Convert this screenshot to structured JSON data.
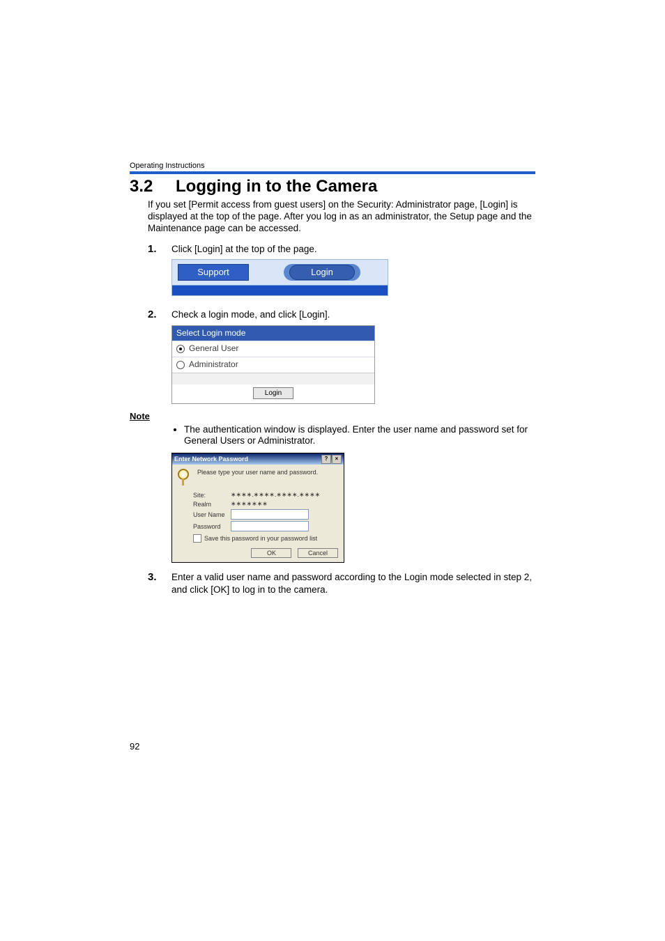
{
  "running_header": "Operating Instructions",
  "section": {
    "number": "3.2",
    "title": "Logging in to the Camera"
  },
  "intro": "If you set [Permit access from guest users] on the Security: Administrator page, [Login] is displayed at the top of the page. After you log in as an administrator, the Setup page and the Maintenance page can be accessed.",
  "steps": {
    "s1": {
      "num": "1.",
      "text": "Click [Login] at the top of the page."
    },
    "s2": {
      "num": "2.",
      "text": "Check a login mode, and click [Login]."
    },
    "s3": {
      "num": "3.",
      "text": "Enter a valid user name and password according to the Login mode selected in step 2, and click [OK] to log in to the camera."
    }
  },
  "shot1": {
    "support_tab": "Support",
    "login_tab": "Login"
  },
  "shot2": {
    "title": "Select Login mode",
    "option1": "General User",
    "option2": "Administrator",
    "login_btn": "Login"
  },
  "note_label": "Note",
  "note_text": "The authentication window is displayed. Enter the user name and password set for General Users or Administrator.",
  "shot3": {
    "title": "Enter Network Password",
    "help_btn": "?",
    "close_btn": "×",
    "prompt": "Please type your user name and password.",
    "site_label": "Site:",
    "site_value": "∗∗∗∗.∗∗∗∗.∗∗∗∗.∗∗∗∗",
    "realm_label": "Realm",
    "realm_value": "∗∗∗∗∗∗∗",
    "username_label": "User Name",
    "password_label": "Password",
    "save_checkbox": "Save this password in your password list",
    "ok_btn": "OK",
    "cancel_btn": "Cancel"
  },
  "page_number": "92"
}
